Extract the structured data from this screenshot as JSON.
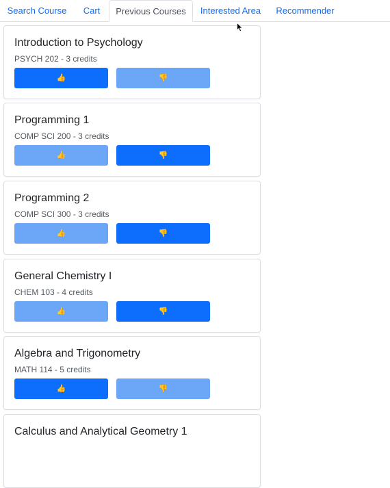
{
  "tabs": [
    {
      "label": "Search Course",
      "active": false
    },
    {
      "label": "Cart",
      "active": false
    },
    {
      "label": "Previous Courses",
      "active": true
    },
    {
      "label": "Interested Area",
      "active": false
    },
    {
      "label": "Recommender",
      "active": false
    }
  ],
  "courses": [
    {
      "title": "Introduction to Psychology",
      "subtitle": "PSYCH 202 - 3 credits",
      "liked": true,
      "disliked": false
    },
    {
      "title": "Programming 1",
      "subtitle": "COMP SCI 200 - 3 credits",
      "liked": false,
      "disliked": true
    },
    {
      "title": "Programming 2",
      "subtitle": "COMP SCI 300 - 3 credits",
      "liked": false,
      "disliked": true
    },
    {
      "title": "General Chemistry I",
      "subtitle": "CHEM 103 - 4 credits",
      "liked": false,
      "disliked": true
    },
    {
      "title": "Algebra and Trigonometry",
      "subtitle": "MATH 114 - 5 credits",
      "liked": true,
      "disliked": false
    },
    {
      "title": "Calculus and Analytical Geometry 1",
      "subtitle": "",
      "liked": false,
      "disliked": false
    }
  ],
  "icons": {
    "like": "thumbs-up-icon",
    "dislike": "thumbs-down-icon"
  },
  "colors": {
    "selected_button": "#0d6efd",
    "unselected_button": "#6ca6f7",
    "link": "#0d6efd"
  }
}
